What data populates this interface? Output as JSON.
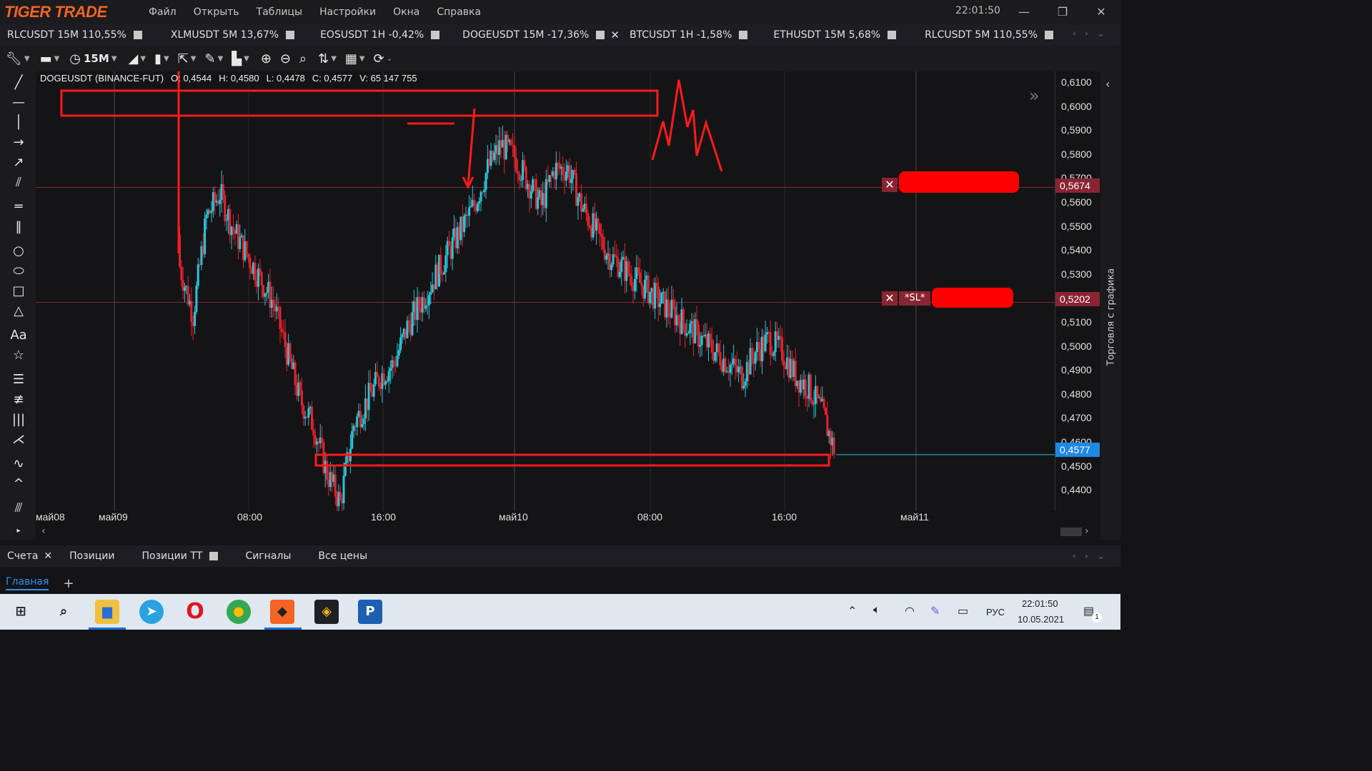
{
  "app": {
    "logo": "TIGER TRADE",
    "clock": "22:01:50"
  },
  "menu": [
    "Файл",
    "Открыть",
    "Таблицы",
    "Настройки",
    "Окна",
    "Справка"
  ],
  "symbol_tabs": [
    {
      "label": "RLCUSDT 15M  110,55%"
    },
    {
      "label": "XLMUSDT 5M  13,67%"
    },
    {
      "label": "EOSUSDT 1H -0,42%"
    },
    {
      "label": "DOGEUSDT 15M -17,36%",
      "active": true
    },
    {
      "label": "BTCUSDT 1H -1,58%"
    },
    {
      "label": "ETHUSDT 15M  5,68%"
    },
    {
      "label": "RLCUSDT 5M  110,55%"
    }
  ],
  "toolbar": {
    "timeframe": "15M"
  },
  "ohlc": {
    "symbol": "DOGEUSDT (BINANCE-FUT)",
    "o": "O: 0,4544",
    "h": "H: 0,4580",
    "l": "L: 0,4478",
    "c": "C: 0,4577",
    "v": "V: 65 147 755"
  },
  "price_axis": {
    "ticks": [
      "0,6100",
      "0,6000",
      "0,5900",
      "0,5800",
      "0,5700",
      "0,5600",
      "0,5500",
      "0,5400",
      "0,5300",
      "0,5200",
      "0,5100",
      "0,5000",
      "0,4900",
      "0,4800",
      "0,4700",
      "0,4600",
      "0,4500",
      "0,4400"
    ],
    "current_price": "0,4577",
    "order_price": "0,5674",
    "sl_price": "0,5202",
    "sl_label": "*SL*"
  },
  "time_axis": [
    "май08",
    "май09",
    "08:00",
    "16:00",
    "май10",
    "08:00",
    "16:00",
    "май11"
  ],
  "right_panel": {
    "label": "Торговля с графика"
  },
  "bottom_tabs": [
    {
      "label": "Счета",
      "closable": true
    },
    {
      "label": "Позиции"
    },
    {
      "label": "Позиции ТТ",
      "square": true
    },
    {
      "label": "Сигналы"
    },
    {
      "label": "Все цены"
    }
  ],
  "workspace": {
    "tab": "Главная",
    "add": "+"
  },
  "taskbar": {
    "lang": "РУС",
    "time": "22:01:50",
    "date": "10.05.2021",
    "notif": "1"
  },
  "colors": {
    "up": "#26c6da",
    "down": "#e8212b",
    "annotation": "#ff1a1a",
    "bg": "#141416"
  },
  "chart_data": {
    "type": "candlestick",
    "symbol": "DOGEUSDT",
    "timeframe": "15M",
    "ylim": [
      0.4345,
      0.615
    ],
    "series": [
      {
        "values_approx_close": [
          0.535,
          0.515,
          0.555,
          0.565,
          0.55,
          0.54,
          0.53,
          0.52,
          0.5,
          0.48,
          0.47,
          0.45,
          0.438,
          0.47,
          0.48,
          0.49,
          0.495,
          0.51,
          0.52,
          0.53,
          0.54,
          0.55,
          0.56,
          0.575,
          0.585,
          0.58,
          0.57,
          0.56,
          0.575,
          0.575,
          0.56,
          0.55,
          0.54,
          0.535,
          0.53,
          0.525,
          0.52,
          0.515,
          0.51,
          0.505,
          0.5,
          0.495,
          0.49,
          0.5,
          0.505,
          0.5,
          0.49,
          0.485,
          0.475,
          0.458
        ]
      }
    ]
  }
}
